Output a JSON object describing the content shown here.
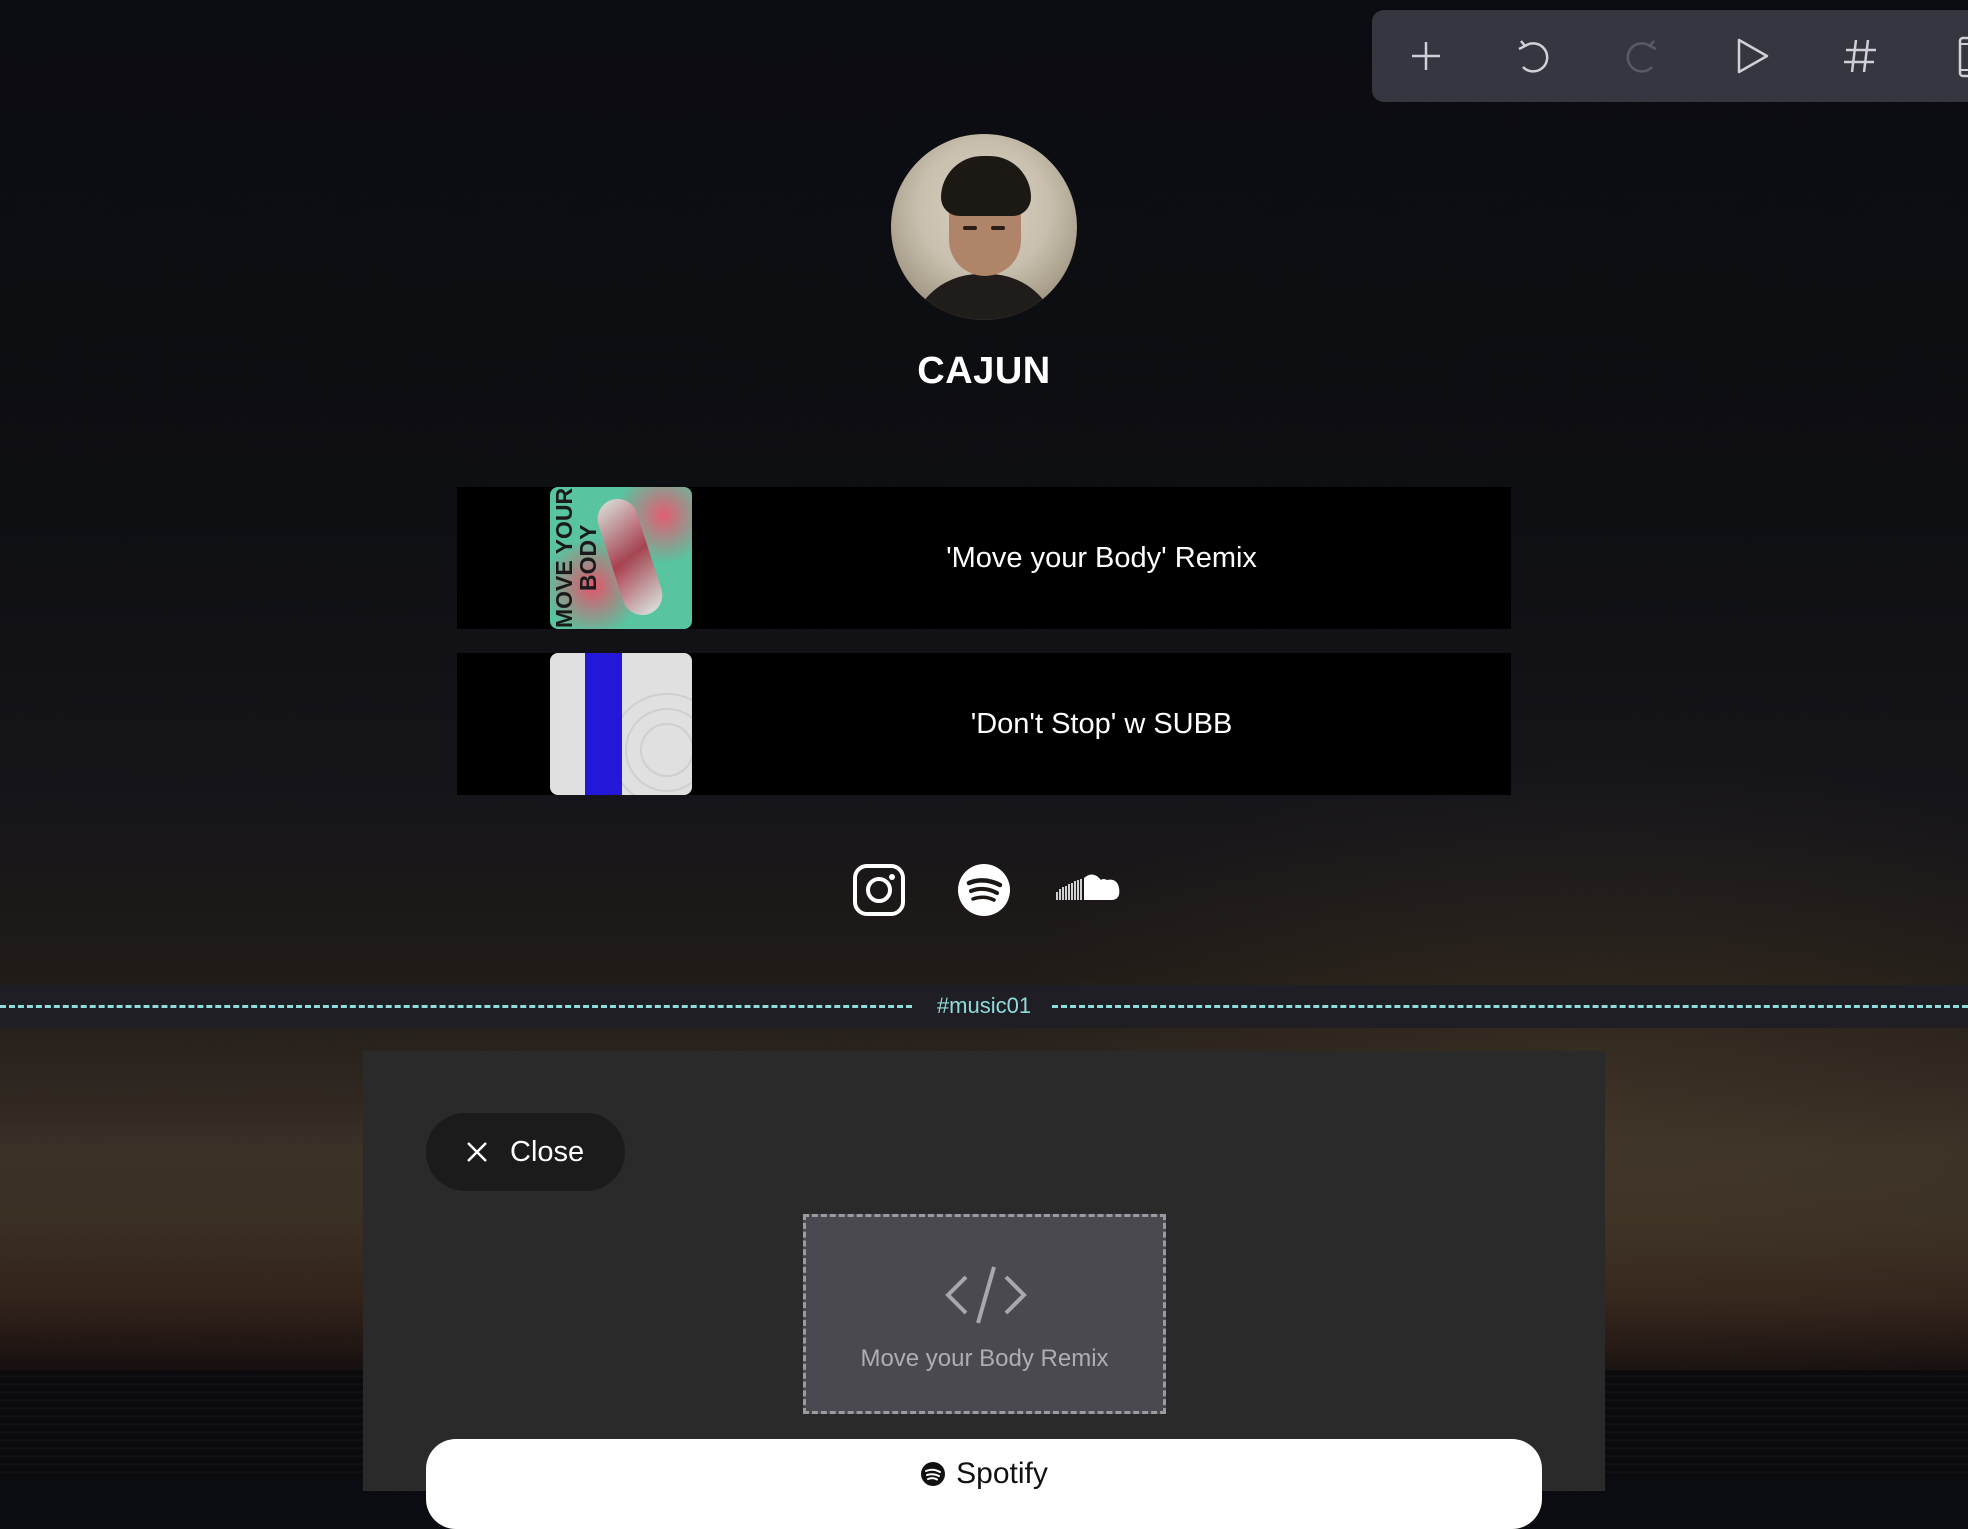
{
  "toolbar": {
    "items": [
      {
        "name": "add",
        "icon": "plus-icon",
        "enabled": true
      },
      {
        "name": "undo",
        "icon": "undo-icon",
        "enabled": true
      },
      {
        "name": "redo",
        "icon": "redo-icon",
        "enabled": false
      },
      {
        "name": "preview",
        "icon": "play-icon",
        "enabled": true
      },
      {
        "name": "sections",
        "icon": "hash-icon",
        "enabled": true
      },
      {
        "name": "device",
        "icon": "device-icon",
        "enabled": true
      }
    ],
    "colors": {
      "background": "#363641",
      "icon": "#d0d0d6",
      "icon_disabled": "#5a5a66"
    }
  },
  "profile": {
    "avatar": "avatar-photo",
    "name": "CAJUN"
  },
  "links": [
    {
      "label": "'Move your Body' Remix",
      "thumbnail": "move-your-body-cover",
      "thumb_text": "MOVE YOUR BODY"
    },
    {
      "label": "'Don't Stop' w SUBB",
      "thumbnail": "dont-stop-cover"
    }
  ],
  "social": [
    {
      "name": "instagram",
      "icon": "instagram-icon"
    },
    {
      "name": "spotify",
      "icon": "spotify-icon"
    },
    {
      "name": "soundcloud",
      "icon": "soundcloud-icon"
    }
  ],
  "section_divider": {
    "tag": "#music01",
    "color": "#8fdcdc"
  },
  "panel": {
    "close_label": "Close",
    "embed_caption": "Move your Body Remix",
    "spotify_button_label": "Spotify"
  }
}
